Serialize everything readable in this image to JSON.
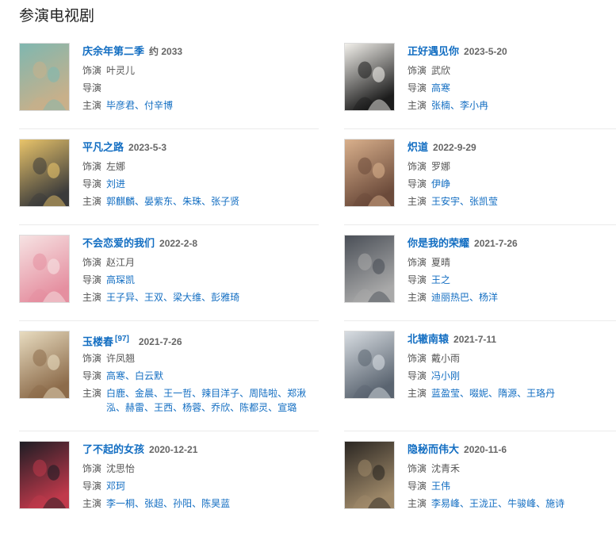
{
  "section_title": "参演电视剧",
  "labels": {
    "role": "饰演",
    "director": "导演",
    "cast": "主演"
  },
  "dramas": [
    {
      "title": "庆余年第二季",
      "date": "约 2033",
      "badge": "",
      "role": "叶灵儿",
      "director": [],
      "cast": [
        "毕彦君",
        "付辛博"
      ],
      "poster_colors": [
        "#7fb7b0",
        "#c8b08a"
      ]
    },
    {
      "title": "正好遇见你",
      "date": "2023-5-20",
      "badge": "",
      "role": "武欣",
      "director": [
        "高寒"
      ],
      "cast": [
        "张楠",
        "李小冉"
      ],
      "poster_colors": [
        "#f2f0eb",
        "#1c1c1c"
      ]
    },
    {
      "title": "平凡之路",
      "date": "2023-5-3",
      "badge": "",
      "role": "左娜",
      "director": [
        "刘进"
      ],
      "cast": [
        "郭麒麟",
        "晏紫东",
        "朱珠",
        "张子贤"
      ],
      "poster_colors": [
        "#e9c46a",
        "#3b3b3b"
      ]
    },
    {
      "title": "炽道",
      "date": "2022-9-29",
      "badge": "",
      "role": "罗娜",
      "director": [
        "伊峥"
      ],
      "cast": [
        "王安宇",
        "张凯莹"
      ],
      "poster_colors": [
        "#d9b08c",
        "#6b4a3a"
      ]
    },
    {
      "title": "不会恋爱的我们",
      "date": "2022-2-8",
      "badge": "",
      "role": "赵江月",
      "director": [
        "高琛凯"
      ],
      "cast": [
        "王子异",
        "王双",
        "梁大维",
        "彭雅琦"
      ],
      "poster_colors": [
        "#f6e3e3",
        "#e58fa0"
      ]
    },
    {
      "title": "你是我的荣耀",
      "date": "2021-7-26",
      "badge": "",
      "role": "夏晴",
      "director": [
        "王之"
      ],
      "cast": [
        "迪丽热巴",
        "杨洋"
      ],
      "poster_colors": [
        "#4a4f57",
        "#a9a9a9"
      ]
    },
    {
      "title": "玉楼春",
      "date": "2021-7-26",
      "badge": "[97]",
      "role": "许凤翘",
      "director": [
        "高寒",
        "白云默"
      ],
      "cast": [
        "白鹿",
        "金晨",
        "王一哲",
        "辣目洋子",
        "周陆啦",
        "郑湫泓",
        "赫雷",
        "王西",
        "杨蓉",
        "乔欣",
        "陈都灵",
        "宣璐"
      ],
      "poster_colors": [
        "#e8dcc0",
        "#8c6b4a"
      ]
    },
    {
      "title": "北辙南辕",
      "date": "2021-7-11",
      "badge": "",
      "role": "戴小雨",
      "director": [
        "冯小刚"
      ],
      "cast": [
        "蓝盈莹",
        "啜妮",
        "隋源",
        "王珞丹"
      ],
      "poster_colors": [
        "#d8dde2",
        "#5a6470"
      ]
    },
    {
      "title": "了不起的女孩",
      "date": "2020-12-21",
      "badge": "",
      "role": "沈思怡",
      "director": [
        "邓珂"
      ],
      "cast": [
        "李一桐",
        "张超",
        "孙阳",
        "陈昊蓝"
      ],
      "poster_colors": [
        "#1d1d24",
        "#c0394b"
      ]
    },
    {
      "title": "隐秘而伟大",
      "date": "2020-11-6",
      "badge": "",
      "role": "沈青禾",
      "director": [
        "王伟"
      ],
      "cast": [
        "李易峰",
        "王泷正",
        "牛骏峰",
        "施诗"
      ],
      "poster_colors": [
        "#2a2622",
        "#a08a6a"
      ]
    }
  ]
}
